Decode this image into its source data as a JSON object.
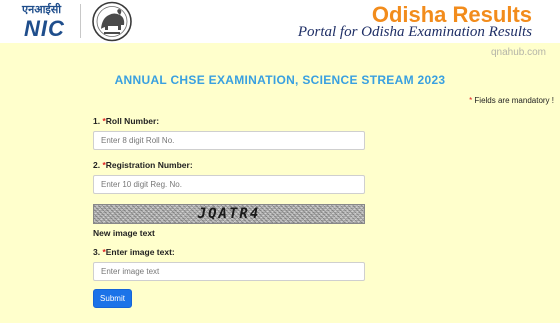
{
  "header": {
    "nic_hindi": "एनआईसी",
    "nic_text": "NIC",
    "site_title": "Odisha Results",
    "site_tagline": "Portal for Odisha Examination Results"
  },
  "watermark": "qnahub.com",
  "form": {
    "title": "ANNUAL CHSE EXAMINATION, SCIENCE STREAM 2023",
    "mandatory_star": "*",
    "mandatory_note": " Fields are mandatory !",
    "roll": {
      "number": "1. ",
      "star": "*",
      "label": "Roll Number:",
      "placeholder": "Enter 8 digit Roll No.",
      "value": ""
    },
    "registration": {
      "number": "2. ",
      "star": "*",
      "label": "Registration Number:",
      "placeholder": "Enter 10 digit Reg. No.",
      "value": ""
    },
    "captcha_text": "JQATR4",
    "new_image_label": "New image text",
    "image_text": {
      "number": "3. ",
      "star": "*",
      "label": "Enter image text:",
      "placeholder": "Enter image text",
      "value": ""
    },
    "submit_label": "Submit"
  },
  "colors": {
    "page_background": "#ffffcc",
    "title_orange": "#f28c1c",
    "tagline_navy": "#1f2f66",
    "exam_title_blue": "#39a0e0",
    "mandatory_red": "#e02020",
    "submit_blue": "#1b73e8",
    "nic_blue": "#1f4e8c"
  }
}
